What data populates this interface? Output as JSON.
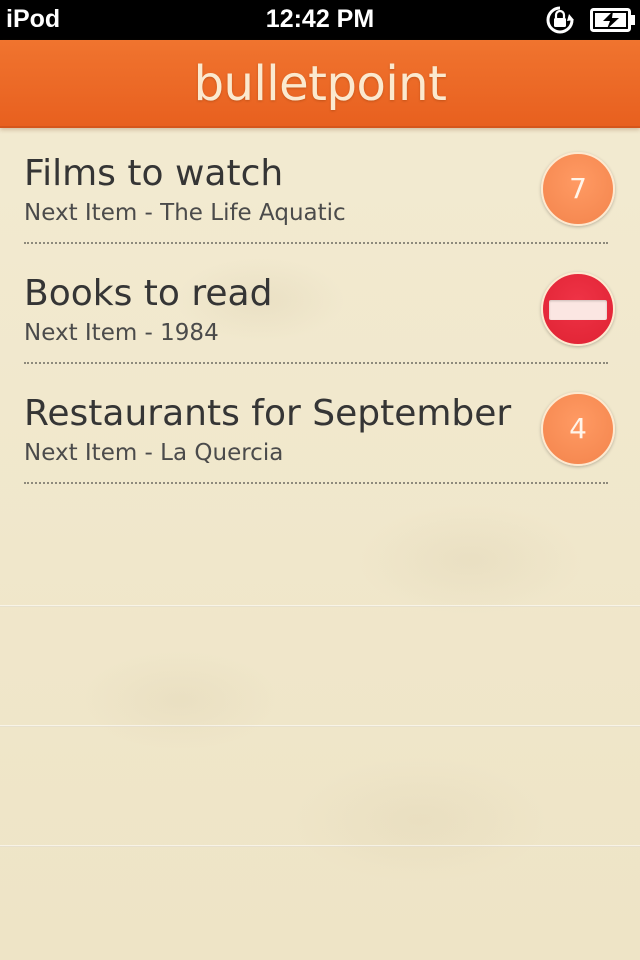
{
  "status_bar": {
    "device": "iPod",
    "time": "12:42 PM",
    "icons": [
      "rotation-lock-icon",
      "battery-charging-icon"
    ]
  },
  "app": {
    "title": "bulletpoint",
    "accent_color": "#ec6a26"
  },
  "lists": [
    {
      "title": "Films to watch",
      "subtitle": "Next Item - The Life Aquatic",
      "badge": "7",
      "badge_type": "count"
    },
    {
      "title": "Books to read",
      "subtitle": "Next Item - 1984",
      "badge": "",
      "badge_type": "done-icon"
    },
    {
      "title": "Restaurants for September",
      "subtitle": "Next Item - La Quercia",
      "badge": "4",
      "badge_type": "count"
    }
  ],
  "colors": {
    "paper": "#f1e8cd",
    "badge_orange": "#f58a50",
    "badge_red": "#e42a3b",
    "text": "#353535"
  }
}
